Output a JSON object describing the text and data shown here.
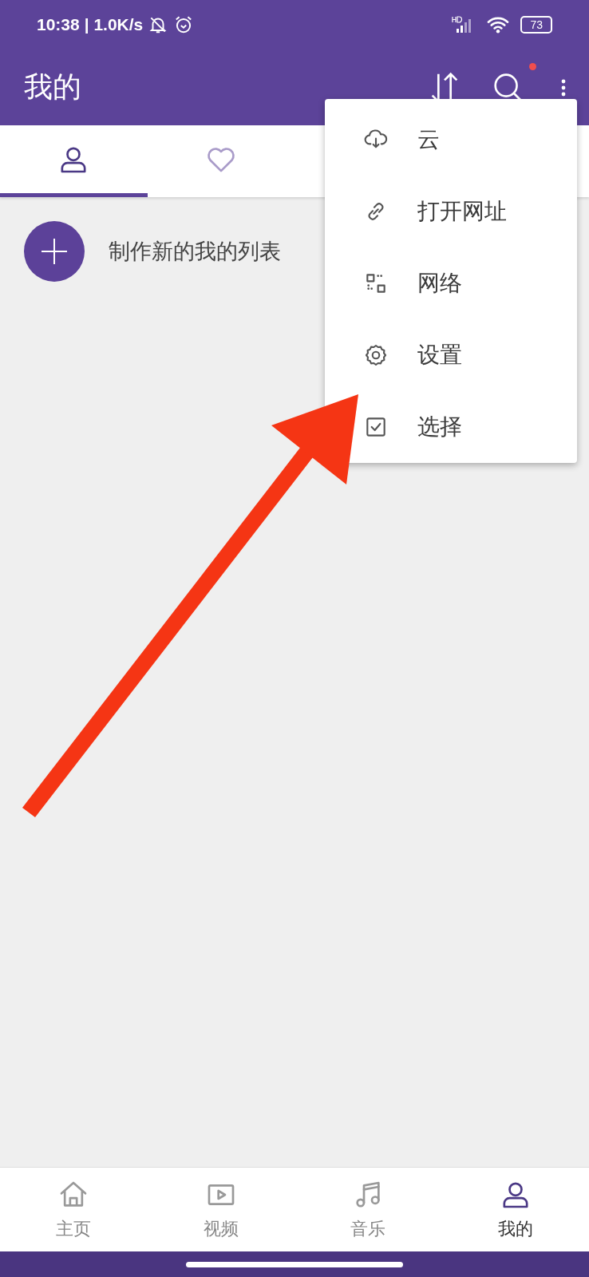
{
  "status_bar": {
    "time": "10:38",
    "speed": "| 1.0K/s",
    "battery": "73"
  },
  "app_bar": {
    "title": "我的",
    "search_badge": true
  },
  "tabs": [
    {
      "kind": "person",
      "selected": true
    },
    {
      "kind": "heart",
      "selected": false
    }
  ],
  "create_list": {
    "label": "制作新的我的列表"
  },
  "menu": [
    {
      "kind": "cloud",
      "label": "云"
    },
    {
      "kind": "link",
      "label": "打开网址"
    },
    {
      "kind": "network",
      "label": "网络"
    },
    {
      "kind": "settings",
      "label": "设置"
    },
    {
      "kind": "select",
      "label": "选择"
    }
  ],
  "bottom_nav": [
    {
      "kind": "home",
      "label": "主页",
      "selected": false
    },
    {
      "kind": "video",
      "label": "视频",
      "selected": false
    },
    {
      "kind": "music",
      "label": "音乐",
      "selected": false
    },
    {
      "kind": "person",
      "label": "我的",
      "selected": true
    }
  ]
}
